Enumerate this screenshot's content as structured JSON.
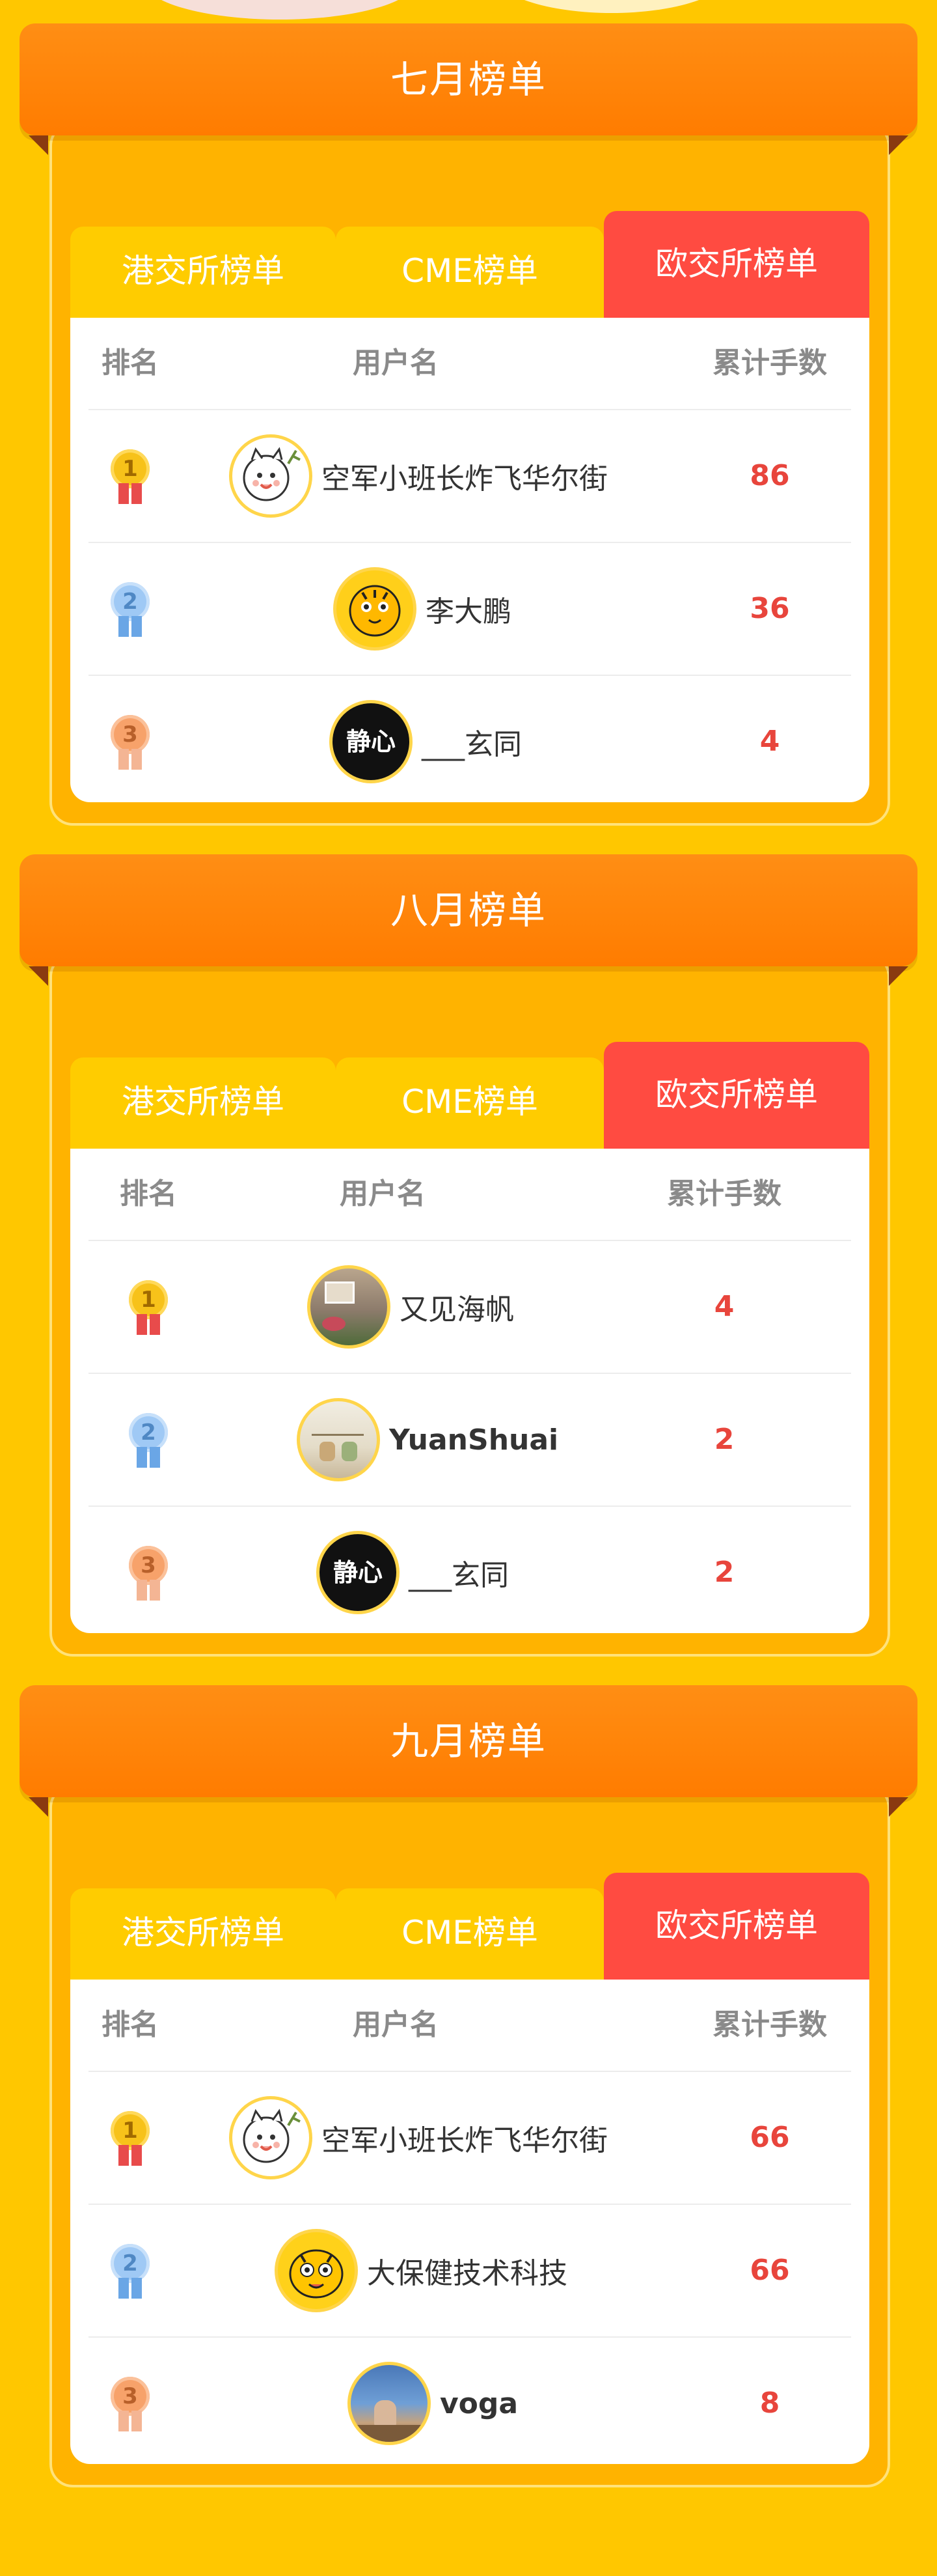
{
  "header_labels": {
    "rank": "排名",
    "username": "用户名",
    "lots": "累计手数"
  },
  "tabs": {
    "hk": "港交所榜单",
    "cme": "CME榜单",
    "ice": "欧交所榜单"
  },
  "sections": [
    {
      "title": "七月榜单",
      "rows": [
        {
          "rank": "1",
          "name": "空军小班长炸飞华尔街",
          "lots": "86",
          "avatar": "cartoon-cat-avatar"
        },
        {
          "rank": "2",
          "name": "李大鹏",
          "lots": "36",
          "avatar": "tiger-avatar"
        },
        {
          "rank": "3",
          "name": "___玄同",
          "lots": "4",
          "avatar": "jingxin-avatar",
          "avatar_text": "静心"
        }
      ]
    },
    {
      "title": "八月榜单",
      "rows": [
        {
          "rank": "1",
          "name": "又见海帆",
          "lots": "4",
          "avatar": "photo-avatar"
        },
        {
          "rank": "2",
          "name": "YuanShuai",
          "lots": "2",
          "avatar": "sketch-avatar"
        },
        {
          "rank": "3",
          "name": "___玄同",
          "lots": "2",
          "avatar": "jingxin-avatar",
          "avatar_text": "静心"
        }
      ]
    },
    {
      "title": "九月榜单",
      "rows": [
        {
          "rank": "1",
          "name": "空军小班长炸飞华尔街",
          "lots": "66",
          "avatar": "cartoon-cat-avatar"
        },
        {
          "rank": "2",
          "name": "大保健技术科技",
          "lots": "66",
          "avatar": "tiger-avatar"
        },
        {
          "rank": "3",
          "name": "voga",
          "lots": "8",
          "avatar": "photo-avatar"
        }
      ]
    }
  ],
  "colors": {
    "background": "#FFC700",
    "header_orange": "#FF8E14",
    "active_tab": "#FF4B41",
    "inactive_tab": "#FFCC00",
    "lots_red": "#E8453C"
  }
}
